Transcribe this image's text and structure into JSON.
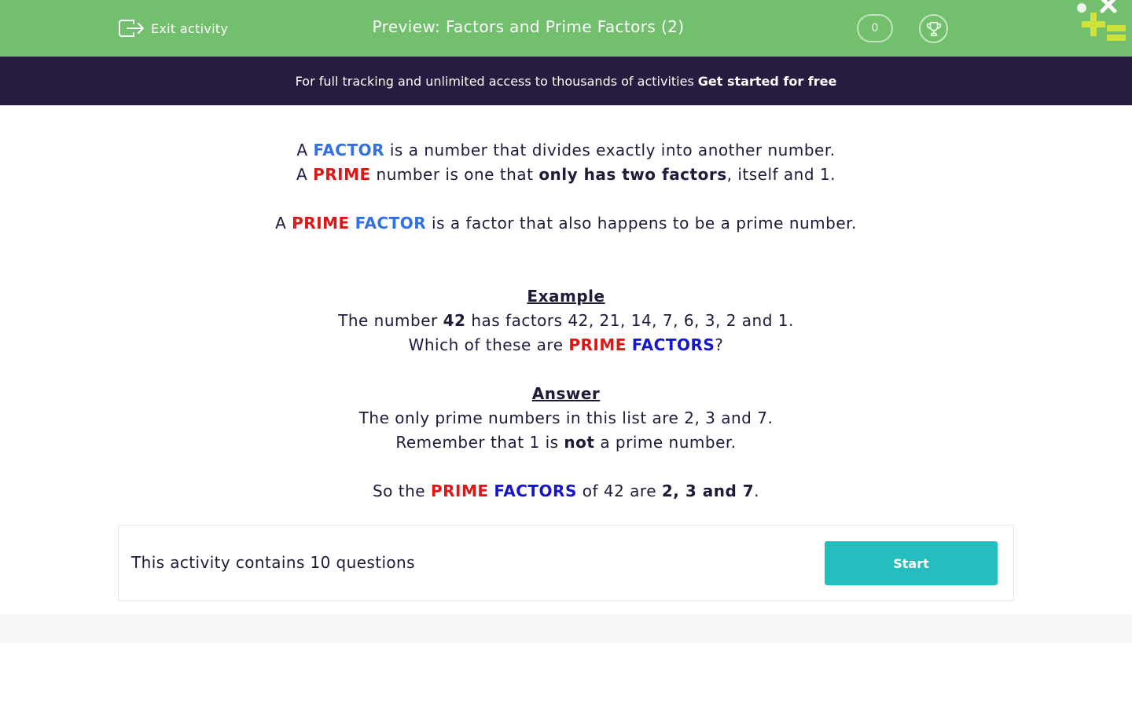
{
  "header": {
    "exit_label": "Exit activity",
    "title": "Preview: Factors and Prime Factors (2)",
    "score": "0",
    "background": "#72c06d"
  },
  "banner": {
    "text": "For full tracking and unlimited access to thousands of activities",
    "cta": "Get started for free",
    "background": "#251c3f"
  },
  "intro": {
    "line1": {
      "a": "A",
      "factor": "FACTOR",
      "rest": "is a number that divides exactly into another number."
    },
    "line2": {
      "a": "A",
      "prime": "PRIME",
      "mid": "number is one that",
      "bold": "only has two factors",
      "rest": ", itself and 1."
    },
    "line3": {
      "a": "A",
      "prime": "PRIME",
      "factor": "FACTOR",
      "rest": "is a factor that also happens to be a prime number."
    }
  },
  "example": {
    "heading": "Example",
    "line1": {
      "pre": "The number",
      "num": "42",
      "rest": "has factors 42, 21, 14, 7, 6, 3, 2 and 1."
    },
    "line2": {
      "pre": "Which of these are",
      "prime": "PRIME",
      "factors": "FACTORS",
      "end": "?"
    }
  },
  "answer": {
    "heading": "Answer",
    "line1": "The only prime numbers in this list are 2, 3 and 7.",
    "line2": {
      "pre": "Remember that 1 is",
      "bold": "not",
      "rest": "a prime number."
    },
    "line3": {
      "pre": "So the",
      "prime": "PRIME",
      "factors": "FACTORS",
      "mid": "of 42 are",
      "bold": "2, 3 and 7",
      "end": "."
    }
  },
  "panel": {
    "text": "This activity contains 10 questions",
    "start_label": "Start",
    "button_color": "#24bebf"
  },
  "colors": {
    "factor_blue": "#3270e6",
    "prime_red": "#e01616",
    "factors_navy": "#1617c8",
    "text": "#1f1a3a"
  },
  "icons": [
    "exit-icon",
    "trophy-icon",
    "decorative-maths-symbols"
  ]
}
